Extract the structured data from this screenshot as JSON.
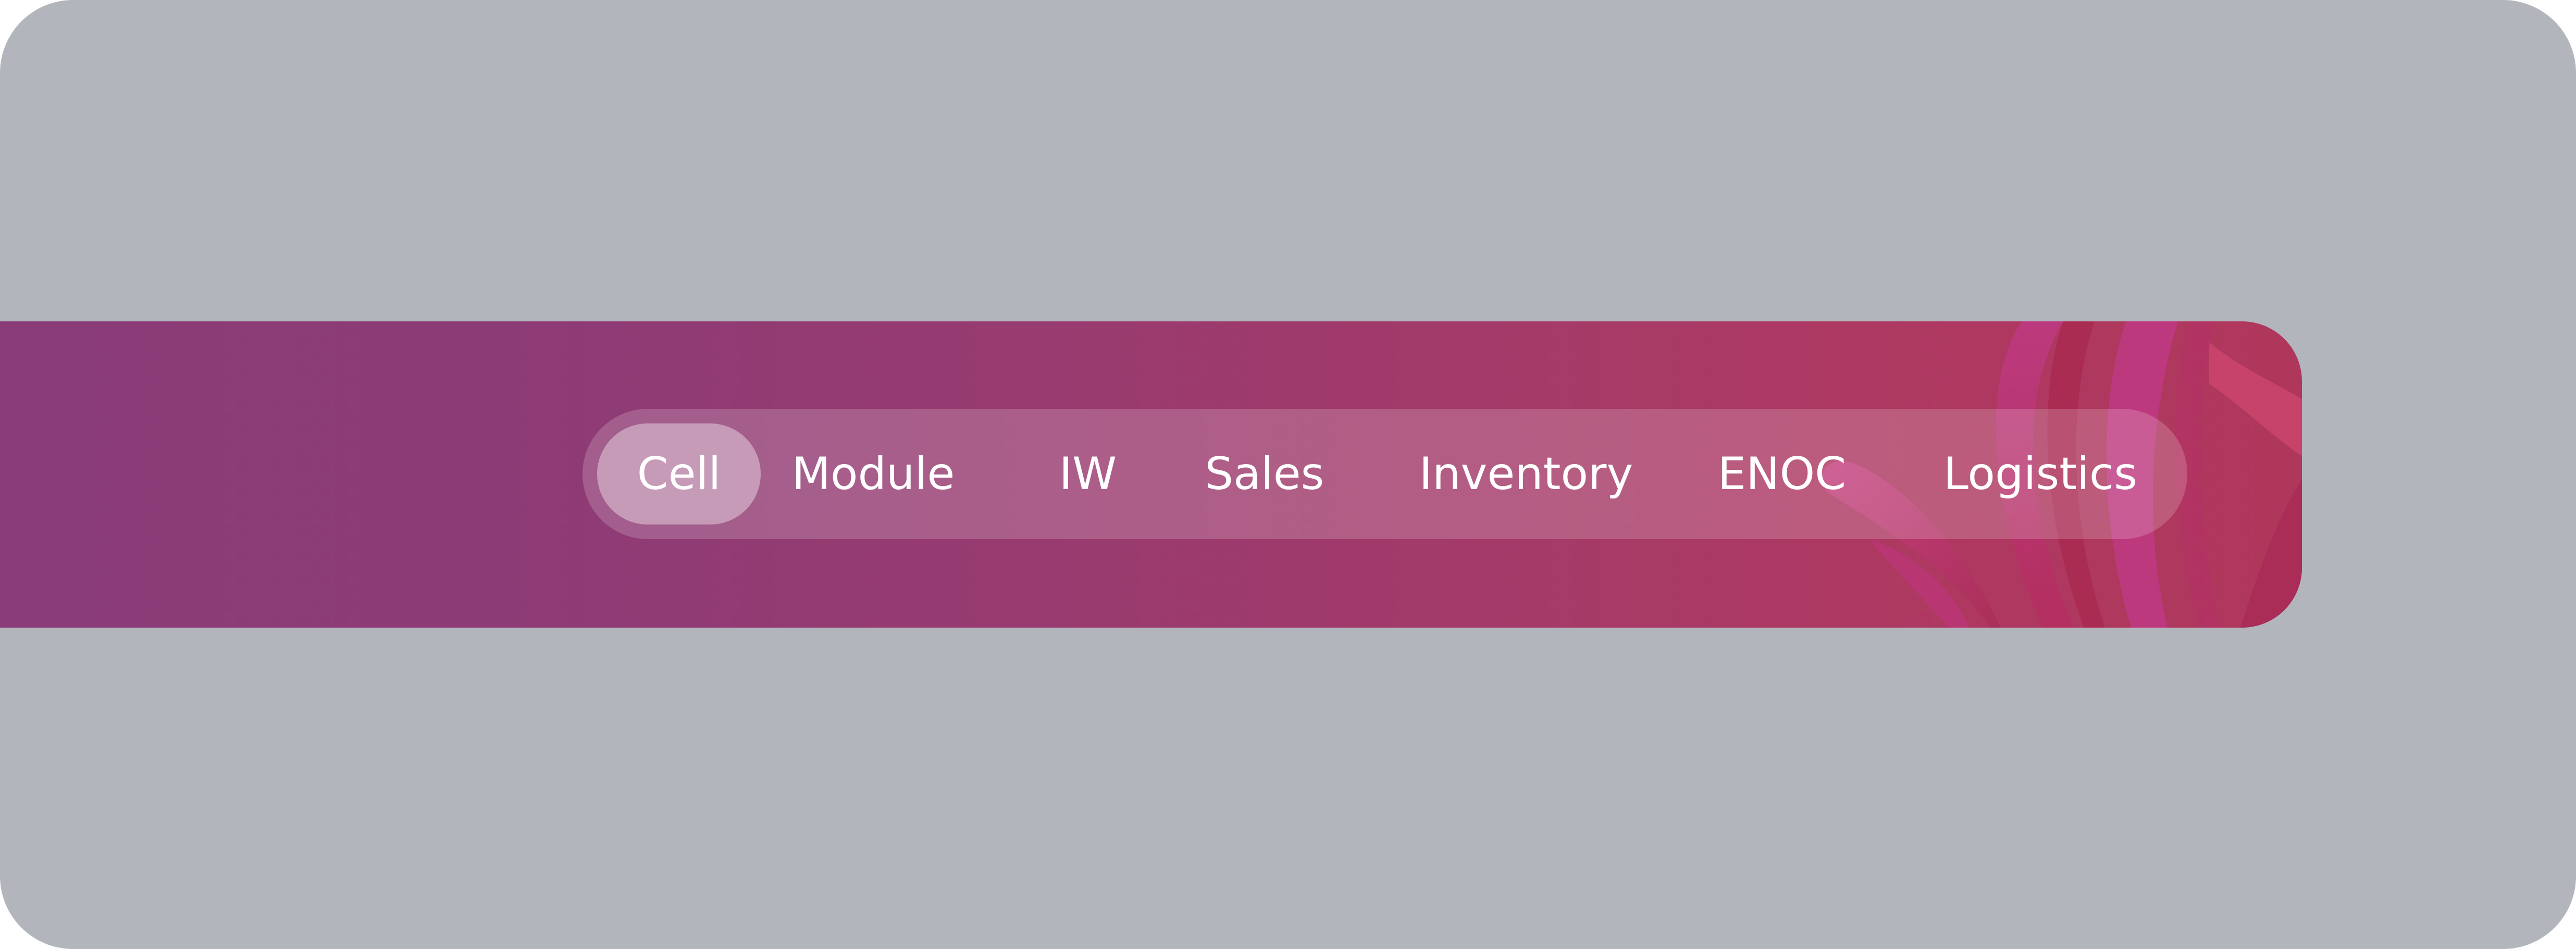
{
  "nav": {
    "active_index": 0,
    "tabs": [
      {
        "label": "Cell"
      },
      {
        "label": "Module"
      },
      {
        "label": "IW"
      },
      {
        "label": "Sales"
      },
      {
        "label": "Inventory"
      },
      {
        "label": "ENOC"
      },
      {
        "label": "Logistics"
      }
    ]
  },
  "colors": {
    "background": "#b3b5bd",
    "banner_start": "#8a3c78",
    "banner_end": "#b0375c",
    "accent_pink": "#c23a8a",
    "text": "#ffffff"
  }
}
